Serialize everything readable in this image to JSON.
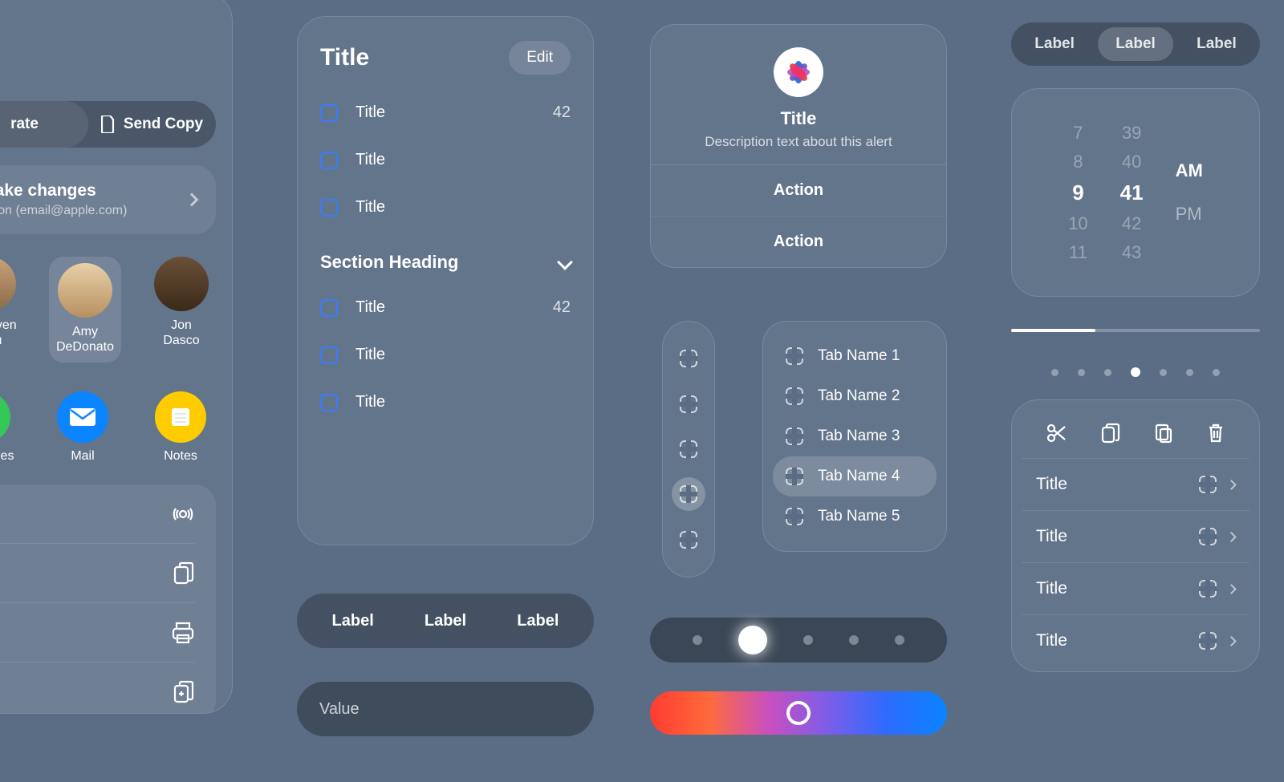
{
  "share_sheet": {
    "seg_left": "rate",
    "seg_right": "Send Copy",
    "card_title": "make changes",
    "card_sub": "Moon (email@apple.com)",
    "people": [
      {
        "name_line1": "Carnaven",
        "name_line2": "Chiu",
        "color": "#caa27a"
      },
      {
        "name_line1": "Amy",
        "name_line2": "DeDonato",
        "color": "#d9b98e",
        "selected": true
      },
      {
        "name_line1": "Jon",
        "name_line2": "Dasco",
        "color": "#b08860"
      }
    ],
    "apps": [
      {
        "name": "Messages",
        "color": "#34c759",
        "icon": "message"
      },
      {
        "name": "Mail",
        "color": "#0a84ff",
        "icon": "mail"
      },
      {
        "name": "Notes",
        "color": "#ffcc00",
        "icon": "notes"
      }
    ],
    "action_icons": [
      "airdrop",
      "copy",
      "print",
      "add"
    ]
  },
  "list_panel": {
    "title": "Title",
    "edit": "Edit",
    "rows1": [
      {
        "label": "Title",
        "value": "42"
      },
      {
        "label": "Title",
        "value": ""
      },
      {
        "label": "Title",
        "value": ""
      }
    ],
    "section": "Section Heading",
    "rows2": [
      {
        "label": "Title",
        "value": "42"
      },
      {
        "label": "Title",
        "value": ""
      },
      {
        "label": "Title",
        "value": ""
      }
    ]
  },
  "seg3_labels": [
    "Label",
    "Label",
    "Label"
  ],
  "value_input": {
    "placeholder": "Value"
  },
  "alert": {
    "title": "Title",
    "description": "Description text about this alert",
    "actions": [
      "Action",
      "Action"
    ]
  },
  "vtabs_count": 5,
  "vtabs_selected_index": 3,
  "tabs": [
    {
      "label": "Tab Name 1"
    },
    {
      "label": "Tab Name 2"
    },
    {
      "label": "Tab Name 3"
    },
    {
      "label": "Tab Name 4",
      "selected": true
    },
    {
      "label": "Tab Name 5"
    }
  ],
  "slider_dots": {
    "count": 5,
    "selected_index": 1
  },
  "top_segmented": {
    "items": [
      "Label",
      "Label",
      "Label"
    ],
    "selected_index": 1
  },
  "timepicker": {
    "hours": [
      "7",
      "8",
      "9",
      "10",
      "11"
    ],
    "minutes": [
      "39",
      "40",
      "41",
      "42",
      "43"
    ],
    "current_hour": "9",
    "current_minute": "41",
    "ampm": [
      "AM",
      "PM"
    ],
    "current_ampm": "AM"
  },
  "progress": {
    "fraction": 0.34
  },
  "page_dots": {
    "count": 7,
    "selected_index": 3
  },
  "edit_menu": {
    "tools": [
      "cut",
      "copy",
      "paste",
      "delete"
    ],
    "items": [
      "Title",
      "Title",
      "Title",
      "Title"
    ]
  }
}
